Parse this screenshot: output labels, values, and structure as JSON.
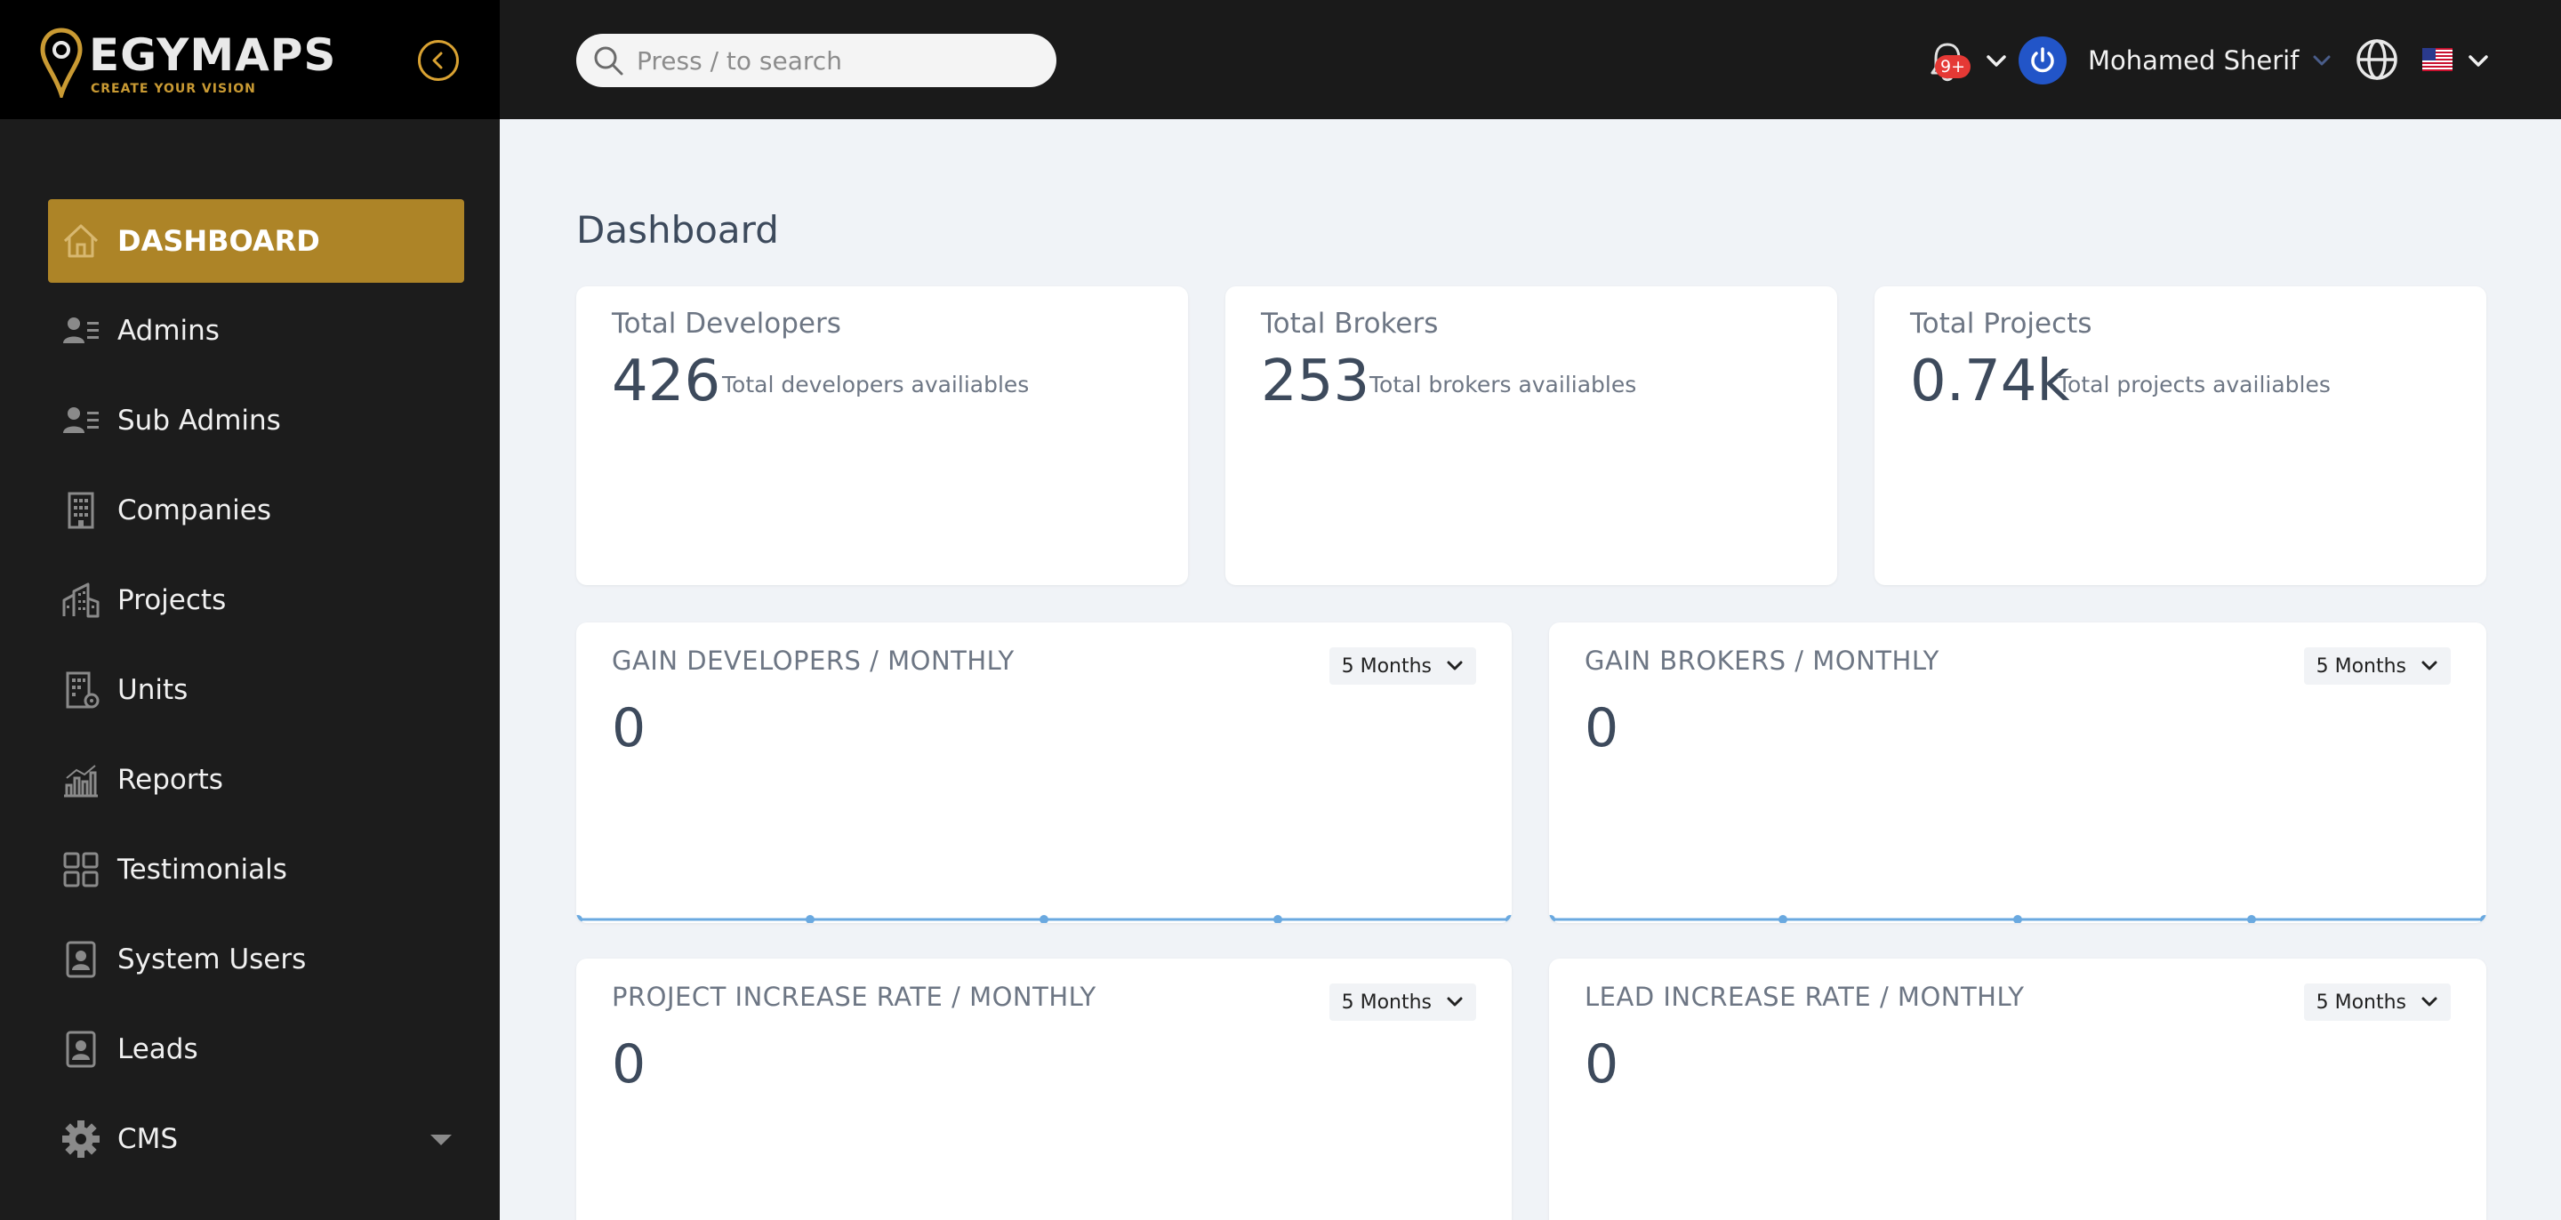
{
  "brand": {
    "name_left": "EGY",
    "name_right": "MAPS",
    "tagline": "CREATE YOUR VISION"
  },
  "search": {
    "placeholder": "Press / to search"
  },
  "header": {
    "notification_badge": "9+",
    "user_name": "Mohamed Sherif"
  },
  "sidebar": {
    "items": [
      {
        "label": "DASHBOARD",
        "icon": "home-icon",
        "active": true
      },
      {
        "label": "Admins",
        "icon": "admins-icon"
      },
      {
        "label": "Sub Admins",
        "icon": "sub-admins-icon"
      },
      {
        "label": "Companies",
        "icon": "building-icon"
      },
      {
        "label": "Projects",
        "icon": "city-icon"
      },
      {
        "label": "Units",
        "icon": "unit-building-icon"
      },
      {
        "label": "Reports",
        "icon": "bar-chart-icon"
      },
      {
        "label": "Testimonials",
        "icon": "grid-icon"
      },
      {
        "label": "System Users",
        "icon": "id-card-icon"
      },
      {
        "label": "Leads",
        "icon": "id-badge-icon"
      },
      {
        "label": "CMS",
        "icon": "gear-icon",
        "has_submenu": true
      }
    ]
  },
  "main": {
    "title": "Dashboard",
    "stats": [
      {
        "title": "Total Developers",
        "value": "426",
        "desc": "Total developers availiables"
      },
      {
        "title": "Total Brokers",
        "value": "253",
        "desc": "Total brokers availiables"
      },
      {
        "title": "Total Projects",
        "value": "0.74k",
        "desc": "Total projects availiables"
      }
    ],
    "charts": [
      {
        "title": "GAIN DEVELOPERS / MONTHLY",
        "value": "0",
        "period": "5 Months"
      },
      {
        "title": "GAIN BROKERS / MONTHLY",
        "value": "0",
        "period": "5 Months"
      },
      {
        "title": "PROJECT INCREASE RATE / MONTHLY",
        "value": "0",
        "period": "5 Months"
      },
      {
        "title": "LEAD INCREASE RATE / MONTHLY",
        "value": "0",
        "period": "5 Months"
      }
    ]
  },
  "colors": {
    "sidebar_bg": "#1c1c1c",
    "active_item": "#ad8427",
    "accent_gold": "#c99a33",
    "chart_line": "#6aa9e0",
    "badge_red": "#e53935"
  }
}
